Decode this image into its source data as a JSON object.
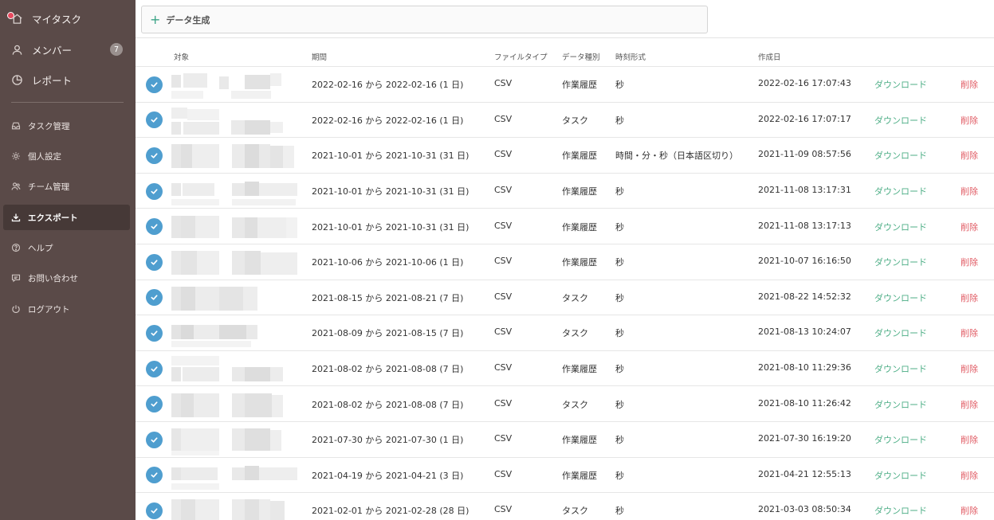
{
  "sidebar": {
    "top_items": [
      {
        "label": "マイタスク",
        "icon": "home-icon"
      },
      {
        "label": "メンバー",
        "icon": "user-icon",
        "badge": "7"
      },
      {
        "label": "レポート",
        "icon": "report-icon"
      }
    ],
    "sub_items": [
      {
        "label": "タスク管理",
        "icon": "inbox-icon"
      },
      {
        "label": "個人設定",
        "icon": "gear-icon"
      },
      {
        "label": "チーム管理",
        "icon": "team-icon"
      },
      {
        "label": "エクスポート",
        "icon": "download-icon"
      },
      {
        "label": "ヘルプ",
        "icon": "help-icon"
      },
      {
        "label": "お問い合わせ",
        "icon": "chat-icon"
      },
      {
        "label": "ログアウト",
        "icon": "power-icon"
      }
    ]
  },
  "toolbar": {
    "generate_label": "データ生成"
  },
  "table": {
    "headers": {
      "target": "対象",
      "period": "期間",
      "file_type": "ファイルタイプ",
      "data_type": "データ種別",
      "time_format": "時刻形式",
      "created": "作成日"
    },
    "download_label": "ダウンロード",
    "delete_label": "削除",
    "rows": [
      {
        "period": "2022-02-16 から 2022-02-16 (1 日)",
        "file_type": "CSV",
        "data_type": "作業履歴",
        "time_format": "秒",
        "created": "2022-02-16 17:07:43"
      },
      {
        "period": "2022-02-16 から 2022-02-16 (1 日)",
        "file_type": "CSV",
        "data_type": "タスク",
        "time_format": "秒",
        "created": "2022-02-16 17:07:17"
      },
      {
        "period": "2021-10-01 から 2021-10-31 (31 日)",
        "file_type": "CSV",
        "data_type": "作業履歴",
        "time_format": "時間・分・秒（日本語区切り）",
        "created": "2021-11-09 08:57:56"
      },
      {
        "period": "2021-10-01 から 2021-10-31 (31 日)",
        "file_type": "CSV",
        "data_type": "作業履歴",
        "time_format": "秒",
        "created": "2021-11-08 13:17:31"
      },
      {
        "period": "2021-10-01 から 2021-10-31 (31 日)",
        "file_type": "CSV",
        "data_type": "作業履歴",
        "time_format": "秒",
        "created": "2021-11-08 13:17:13"
      },
      {
        "period": "2021-10-06 から 2021-10-06 (1 日)",
        "file_type": "CSV",
        "data_type": "作業履歴",
        "time_format": "秒",
        "created": "2021-10-07 16:16:50"
      },
      {
        "period": "2021-08-15 から 2021-08-21 (7 日)",
        "file_type": "CSV",
        "data_type": "タスク",
        "time_format": "秒",
        "created": "2021-08-22 14:52:32"
      },
      {
        "period": "2021-08-09 から 2021-08-15 (7 日)",
        "file_type": "CSV",
        "data_type": "タスク",
        "time_format": "秒",
        "created": "2021-08-13 10:24:07"
      },
      {
        "period": "2021-08-02 から 2021-08-08 (7 日)",
        "file_type": "CSV",
        "data_type": "作業履歴",
        "time_format": "秒",
        "created": "2021-08-10 11:29:36"
      },
      {
        "period": "2021-08-02 から 2021-08-08 (7 日)",
        "file_type": "CSV",
        "data_type": "タスク",
        "time_format": "秒",
        "created": "2021-08-10 11:26:42"
      },
      {
        "period": "2021-07-30 から 2021-07-30 (1 日)",
        "file_type": "CSV",
        "data_type": "作業履歴",
        "time_format": "秒",
        "created": "2021-07-30 16:19:20"
      },
      {
        "period": "2021-04-19 から 2021-04-21 (3 日)",
        "file_type": "CSV",
        "data_type": "作業履歴",
        "time_format": "秒",
        "created": "2021-04-21 12:55:13"
      },
      {
        "period": "2021-02-01 から 2021-02-28 (28 日)",
        "file_type": "CSV",
        "data_type": "タスク",
        "time_format": "秒",
        "created": "2021-03-03 08:50:34"
      }
    ]
  }
}
